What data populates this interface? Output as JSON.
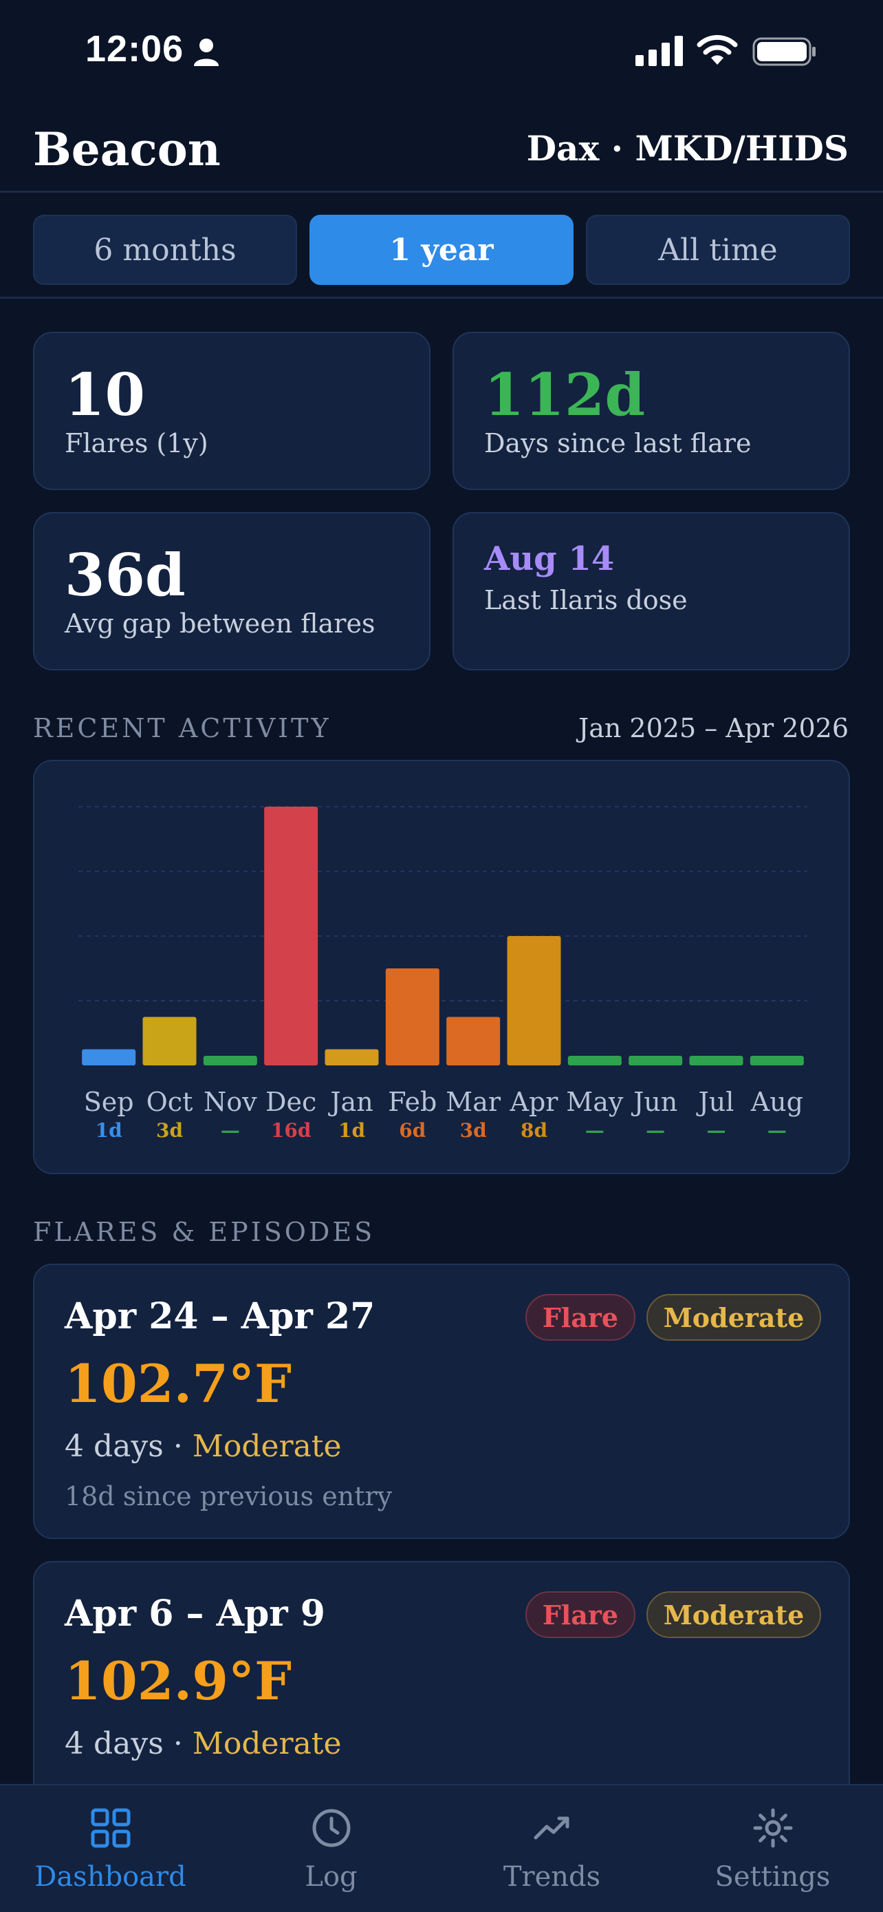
{
  "status_bar": {
    "time": "12:06"
  },
  "header": {
    "title": "Beacon",
    "patient": "Dax · MKD/HIDS"
  },
  "range": {
    "options": [
      "6 months",
      "1 year",
      "All time"
    ],
    "selected": "1 year"
  },
  "stats": {
    "flares": {
      "value": "10",
      "label": "Flares (1y)"
    },
    "days_since": {
      "value": "112d",
      "label": "Days since last flare"
    },
    "avg_gap": {
      "value": "36d",
      "label": "Avg gap between flares"
    },
    "last_dose": {
      "value": "Aug 14",
      "label": "Last Ilaris dose"
    }
  },
  "activity": {
    "title": "RECENT ACTIVITY",
    "range": "Jan 2025 – Apr 2026"
  },
  "chart_data": {
    "type": "bar",
    "categories": [
      "Sep",
      "Oct",
      "Nov",
      "Dec",
      "Jan",
      "Feb",
      "Mar",
      "Apr",
      "May",
      "Jun",
      "Jul",
      "Aug"
    ],
    "values": [
      1,
      3,
      0,
      16,
      1,
      6,
      3,
      8,
      0,
      0,
      0,
      0
    ],
    "value_labels": [
      "1d",
      "3d",
      "—",
      "16d",
      "1d",
      "6d",
      "3d",
      "8d",
      "—",
      "—",
      "—",
      "—"
    ],
    "colors": [
      "#3b8de8",
      "#c9a418",
      "#2fa24f",
      "#d3414a",
      "#d49a1c",
      "#dc6a22",
      "#dc6a22",
      "#d18d16",
      "#2fa24f",
      "#2fa24f",
      "#2fa24f",
      "#2fa24f"
    ],
    "ylim": [
      0,
      16
    ],
    "grid": true
  },
  "flares_section": {
    "title": "FLARES & EPISODES"
  },
  "flares": [
    {
      "dates": "Apr 24 – Apr 27",
      "type": "Flare",
      "severity": "Moderate",
      "temp": "102.7°F",
      "duration": "4 days",
      "sep": " · ",
      "since": "18d since previous entry"
    },
    {
      "dates": "Apr 6 – Apr 9",
      "type": "Flare",
      "severity": "Moderate",
      "temp": "102.9°F",
      "duration": "4 days",
      "sep": " · ",
      "since": ""
    }
  ],
  "tabs": [
    {
      "label": "Dashboard",
      "icon": "grid-icon",
      "active": true
    },
    {
      "label": "Log",
      "icon": "clock-icon",
      "active": false
    },
    {
      "label": "Trends",
      "icon": "trend-icon",
      "active": false
    },
    {
      "label": "Settings",
      "icon": "gear-icon",
      "active": false
    }
  ],
  "colors": {
    "accent": "#2e8be8",
    "green": "#3cb556",
    "purple": "#a78bfa",
    "orange": "#f59f1b"
  }
}
